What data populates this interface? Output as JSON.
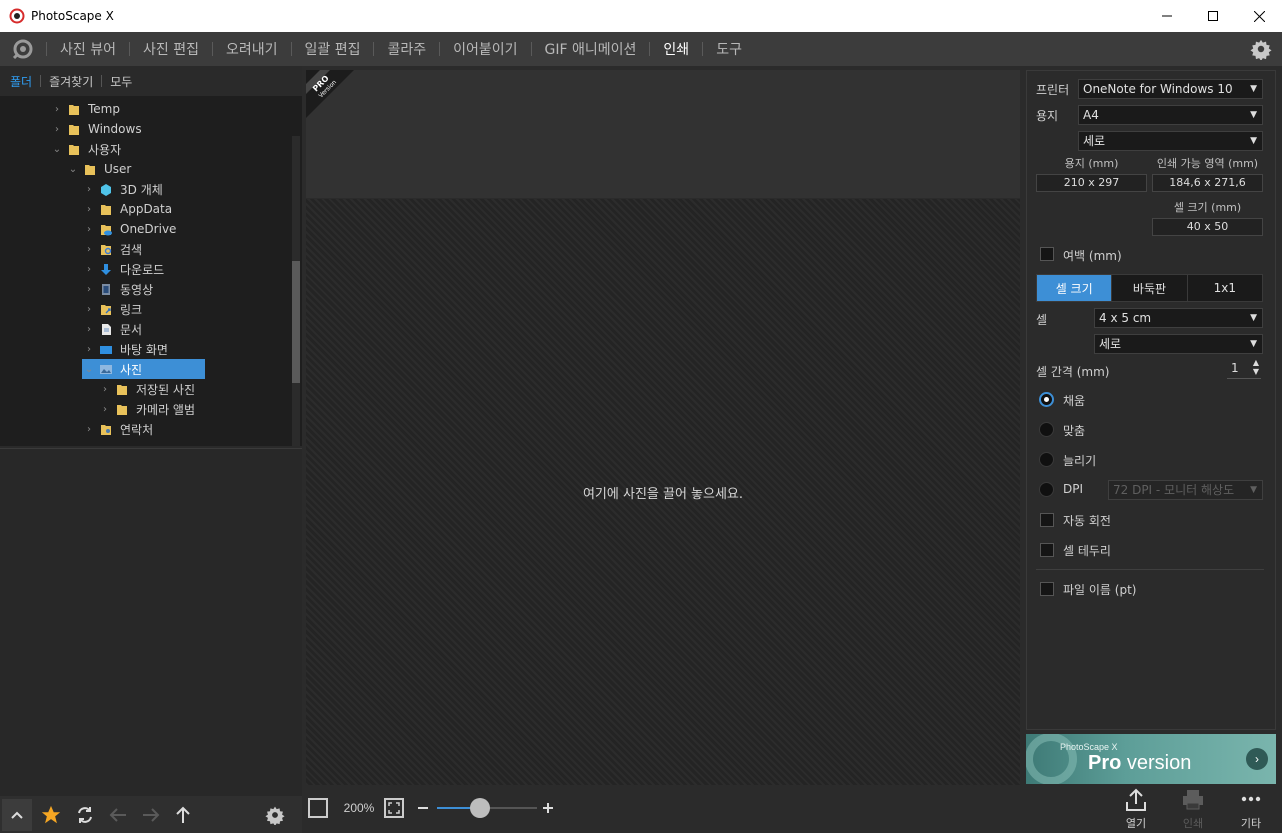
{
  "window": {
    "title": "PhotoScape X",
    "controls": [
      "minimize-icon",
      "maximize-icon",
      "close-icon"
    ]
  },
  "menu": {
    "items": [
      {
        "label": "사진 뷰어",
        "active": false
      },
      {
        "label": "사진 편집",
        "active": false
      },
      {
        "label": "오려내기",
        "active": false
      },
      {
        "label": "일괄 편집",
        "active": false
      },
      {
        "label": "콜라주",
        "active": false
      },
      {
        "label": "이어붙이기",
        "active": false
      },
      {
        "label": "GIF 애니메이션",
        "active": false
      },
      {
        "label": "인쇄",
        "active": true
      },
      {
        "label": "도구",
        "active": false
      }
    ]
  },
  "left": {
    "tabs": [
      "폴더",
      "즐겨찾기",
      "모두"
    ],
    "tree": [
      {
        "label": "Temp",
        "icon": "folder-icon"
      },
      {
        "label": "Windows",
        "icon": "folder-icon"
      },
      {
        "label": "사용자",
        "icon": "folder-icon"
      },
      {
        "label": "User",
        "icon": "folder-icon"
      },
      {
        "label": "3D 개체",
        "icon": "3d-objects-icon"
      },
      {
        "label": "AppData",
        "icon": "folder-icon"
      },
      {
        "label": "OneDrive",
        "icon": "onedrive-folder-icon"
      },
      {
        "label": "검색",
        "icon": "search-folder-icon"
      },
      {
        "label": "다운로드",
        "icon": "download-icon"
      },
      {
        "label": "동영상",
        "icon": "videos-icon"
      },
      {
        "label": "링크",
        "icon": "links-folder-icon"
      },
      {
        "label": "문서",
        "icon": "documents-icon"
      },
      {
        "label": "바탕 화면",
        "icon": "desktop-icon"
      },
      {
        "label": "사진",
        "icon": "pictures-icon"
      },
      {
        "label": "저장된 사진",
        "icon": "folder-icon"
      },
      {
        "label": "카메라 앨범",
        "icon": "folder-icon"
      },
      {
        "label": "연락처",
        "icon": "contacts-icon"
      }
    ]
  },
  "center": {
    "pro_badge_line1": "PRO",
    "pro_badge_line2": "Version",
    "drop_hint": "여기에 사진을 끌어 놓으세요."
  },
  "right": {
    "printer_label": "프린터",
    "printer_value": "OneNote for Windows 10",
    "paper_label": "용지",
    "paper_value": "A4",
    "orientation_value": "세로",
    "paper_size_label": "용지 (mm)",
    "paper_size_value": "210 x 297",
    "printable_label": "인쇄 가능 영역 (mm)",
    "printable_value": "184,6 x 271,6",
    "cell_size_label": "셀 크기 (mm)",
    "cell_size_value": "40 x 50",
    "margin_label": "여백 (mm)",
    "seg": [
      "셀 크기",
      "바둑판",
      "1x1"
    ],
    "cell_label": "셀",
    "cell_value": "4 x 5 cm",
    "cell_orientation": "세로",
    "gap_label": "셀 간격 (mm)",
    "gap_value": "1",
    "fill_label": "채움",
    "fit_label": "맞춤",
    "stretch_label": "늘리기",
    "dpi_label": "DPI",
    "dpi_value": "72 DPI - 모니터 해상도",
    "auto_rotate_label": "자동 회전",
    "cell_border_label": "셀 테두리",
    "filename_label": "파일 이름 (pt)"
  },
  "banner": {
    "small": "PhotoScape X",
    "pro": "Pro",
    "version": " version"
  },
  "bottom": {
    "zoom": "200%",
    "open_label": "열기",
    "print_label": "인쇄",
    "more_label": "기타"
  },
  "colors": {
    "accent": "#3d8fd6",
    "panel": "#2b2b2b",
    "star": "#f5a623"
  }
}
